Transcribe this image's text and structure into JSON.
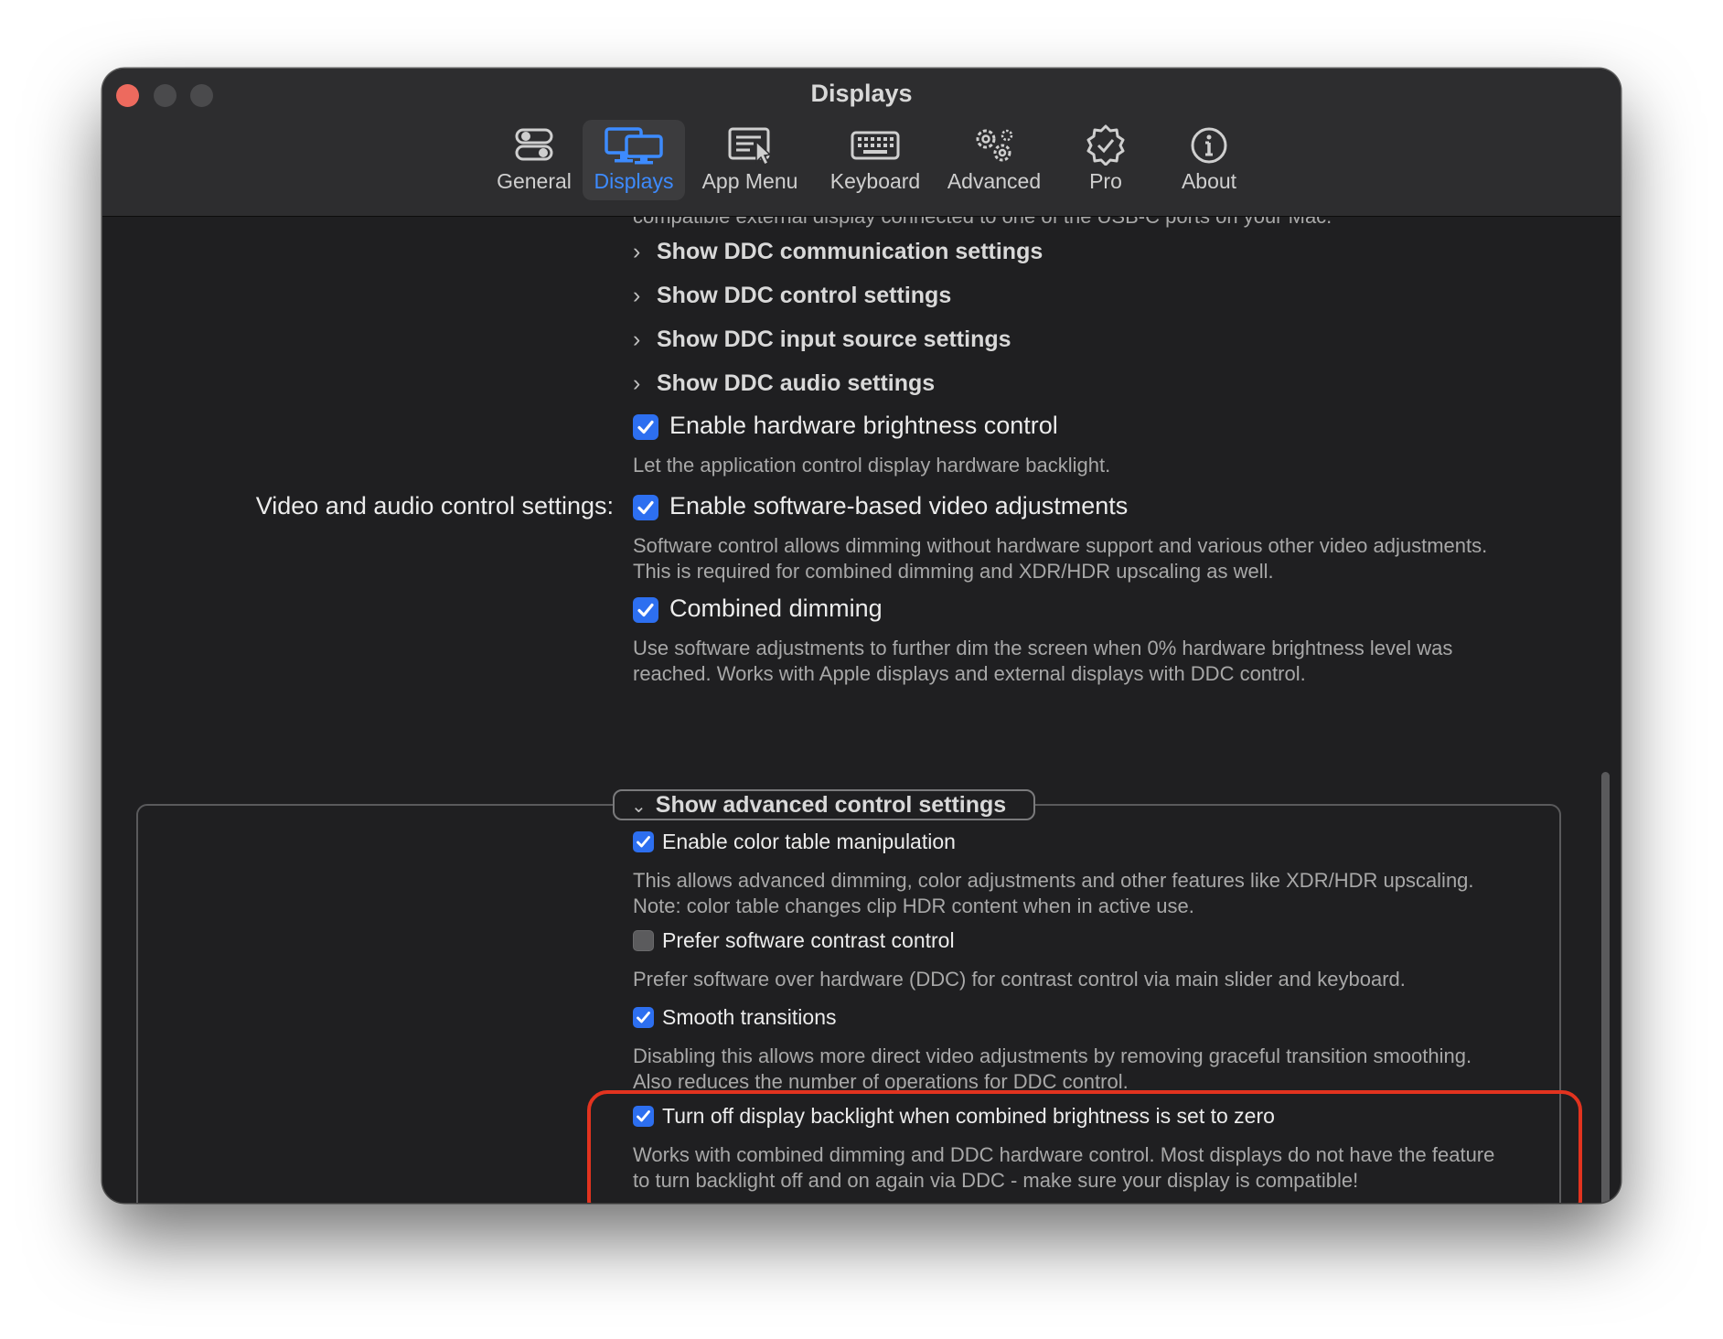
{
  "window": {
    "title": "Displays"
  },
  "tabs": [
    {
      "label": "General",
      "icon": "toggles-icon"
    },
    {
      "label": "Displays",
      "icon": "displays-icon",
      "active": true
    },
    {
      "label": "App Menu",
      "icon": "app-menu-icon"
    },
    {
      "label": "Keyboard",
      "icon": "keyboard-icon"
    },
    {
      "label": "Advanced",
      "icon": "gears-icon"
    },
    {
      "label": "Pro",
      "icon": "verified-badge-icon"
    },
    {
      "label": "About",
      "icon": "info-icon"
    }
  ],
  "content": {
    "partial_description": "compatible external display connected to one of the USB-C ports on your Mac.",
    "disclosures": [
      "Show DDC communication settings",
      "Show DDC control settings",
      "Show DDC input source settings",
      "Show DDC audio settings"
    ],
    "hardware_brightness": {
      "label": "Enable hardware brightness control",
      "checked": true,
      "description": "Let the application control display hardware backlight."
    },
    "video_audio_section_label": "Video and audio control settings:",
    "software_video": {
      "label": "Enable software-based video adjustments",
      "checked": true,
      "description_line1": "Software control allows dimming without hardware support and  various other video adjustments.",
      "description_line2": "This is required for combined dimming and XDR/HDR upscaling as well."
    },
    "combined_dimming": {
      "label": "Combined dimming",
      "checked": true,
      "description_line1": "Use software adjustments to further dim the screen when 0% hardware brightness level was",
      "description_line2": "reached. Works with Apple displays and external displays with DDC control."
    },
    "advanced_header": "Show advanced control settings",
    "color_table": {
      "label": "Enable color table manipulation",
      "checked": true,
      "description_line1": "This allows advanced dimming, color adjustments and other features like XDR/HDR upscaling.",
      "description_line2": "Note: color table changes clip HDR content when in active use."
    },
    "software_contrast": {
      "label": "Prefer software contrast control",
      "checked": false,
      "description": "Prefer software over hardware (DDC) for contrast control via main slider and keyboard."
    },
    "smooth_transitions": {
      "label": "Smooth transitions",
      "checked": true,
      "description_line1": "Disabling this allows more direct video adjustments by removing graceful transition smoothing.",
      "description_line2": "Also reduces the number of operations for DDC control."
    },
    "backlight_off": {
      "label": "Turn off display backlight when combined brightness is set to zero",
      "checked": true,
      "description_line1": "Works with combined dimming and DDC hardware control. Most displays do not have the feature",
      "description_line2": "to turn backlight off and on again via DDC - make sure your display is compatible!"
    }
  },
  "colors": {
    "accent": "#3d8bff",
    "checkbox": "#2d6ff0",
    "highlight": "#e2331f",
    "window_bg": "#1f1f21"
  }
}
